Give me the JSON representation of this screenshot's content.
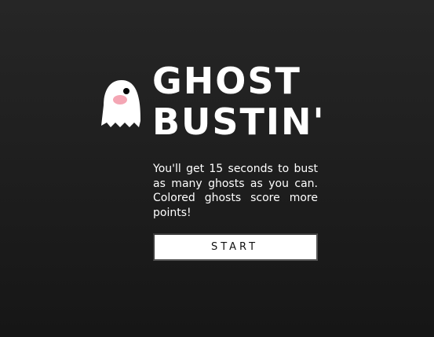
{
  "game": {
    "title_line1": "GHOST",
    "title_line2": "BUSTIN'",
    "description": "You'll get 15 seconds to bust as many ghosts as you can. Colored ghosts score more points!",
    "start_label": "START",
    "mascot_icon": "ghost-icon"
  },
  "colors": {
    "background": "#1e1e1e",
    "text": "#ffffff",
    "ghost_body": "#ffffff",
    "ghost_cheek": "#f4a6b4",
    "ghost_eye": "#000000",
    "button_bg": "#ffffff",
    "button_text": "#111111"
  }
}
